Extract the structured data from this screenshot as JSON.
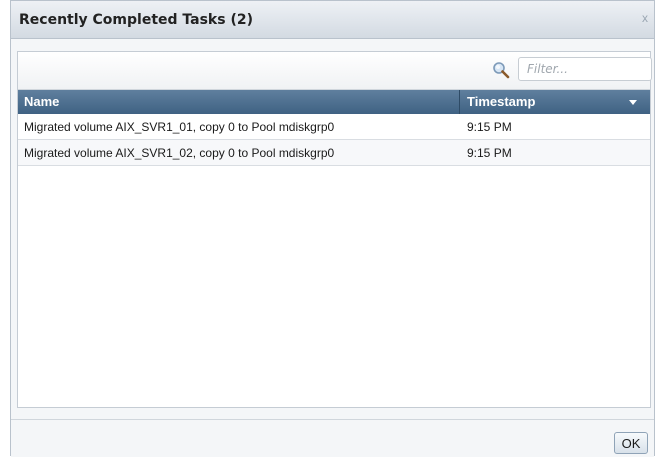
{
  "dialog": {
    "title": "Recently Completed Tasks (2)",
    "close_glyph": "x"
  },
  "toolbar": {
    "filter_placeholder": "Filter...",
    "search_icon": "search-icon"
  },
  "table": {
    "columns": [
      {
        "label": "Name"
      },
      {
        "label": "Timestamp",
        "sort": "descending"
      }
    ],
    "rows": [
      {
        "name": "Migrated volume AIX_SVR1_01, copy 0 to Pool mdiskgrp0",
        "timestamp": "9:15 PM"
      },
      {
        "name": "Migrated volume AIX_SVR1_02, copy 0 to Pool mdiskgrp0",
        "timestamp": "9:15 PM"
      }
    ]
  },
  "footer": {
    "ok_label": "OK"
  },
  "colors": {
    "header_bg": "#4a6b8c",
    "title_gradient_top": "#eef1f5",
    "title_gradient_bottom": "#d3dae2"
  }
}
